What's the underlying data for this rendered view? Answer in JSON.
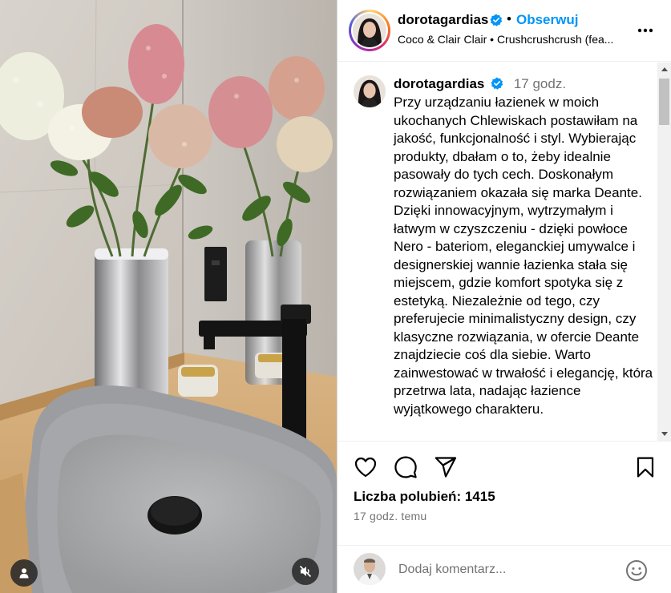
{
  "post": {
    "author": {
      "username": "dorotagardias",
      "verified": true
    },
    "follow_label": "Obserwuj",
    "separator": "•",
    "audio": {
      "artist": "Coco & Clair Clair",
      "track": "Crushcrushcrush (fea..."
    },
    "caption": {
      "username": "dorotagardias",
      "time": "17 godz.",
      "text": "Przy urządzaniu łazienek w moich ukochanych Chlewiskach postawiłam na jakość, funkcjonalność i styl. Wybierając produkty, dbałam o to, żeby idealnie pasowały do tych cech. Doskonałym rozwiązaniem okazała się marka Deante. Dzięki innowacyjnym, wytrzymałym i łatwym w czyszczeniu - dzięki powłoce Nero - bateriom, eleganckiej umywalce i designerskiej wannie łazienka stała się miejscem, gdzie komfort spotyka się z estetyką. Niezależnie od tego, czy preferujecie minimalistyczny design, czy klasyczne rozwiązania, w ofercie Deante znajdziecie coś dla siebie. Warto zainwestować w trwałość i elegancję, która przetrwa lata, nadając łazience wyjątkowego charakteru."
    },
    "likes_label": "Liczba polubień: 1415",
    "time_ago": "17 godz. temu",
    "comment_placeholder": "Dodaj komentarz..."
  },
  "icons": {
    "like": "heart-icon",
    "comment": "comment-icon",
    "share": "paper-plane-icon",
    "save": "bookmark-icon",
    "more": "more-horizontal-icon",
    "emoji": "emoji-icon",
    "mute": "speaker-muted-icon",
    "tags": "user-tag-icon",
    "verified": "verified-badge-icon"
  },
  "colors": {
    "link_blue": "#0095f6",
    "verified_blue": "#0095f6",
    "muted_text": "#737373"
  }
}
